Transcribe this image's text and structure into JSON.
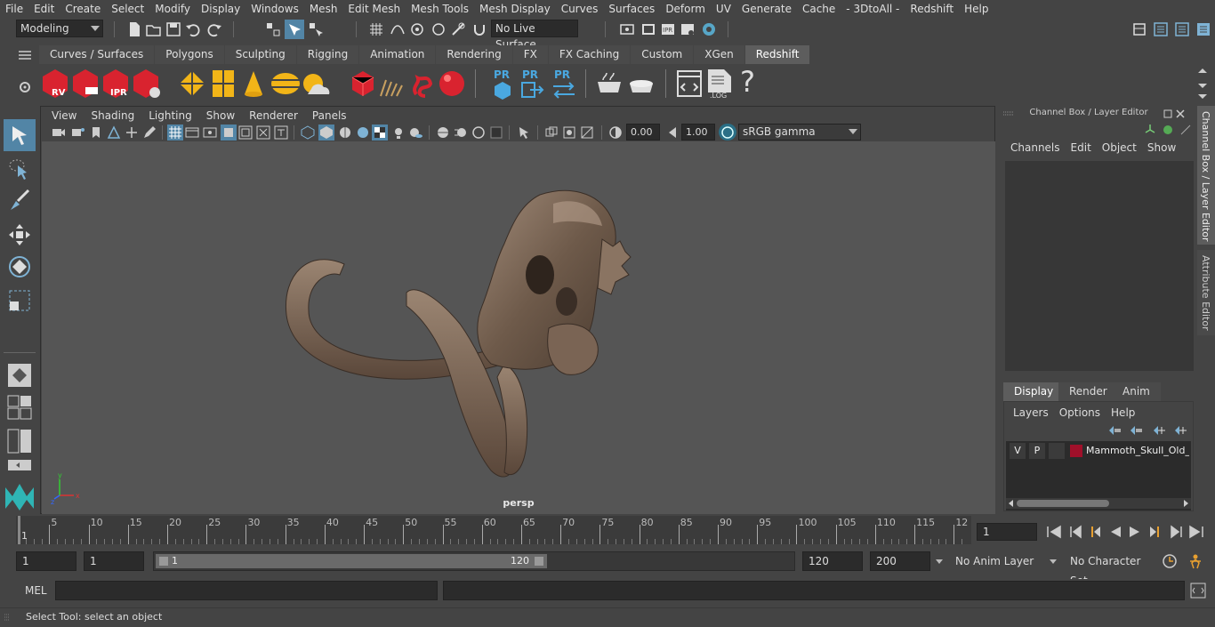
{
  "menubar": {
    "items": [
      "File",
      "Edit",
      "Create",
      "Select",
      "Modify",
      "Display",
      "Windows",
      "Mesh",
      "Edit Mesh",
      "Mesh Tools",
      "Mesh Display",
      "Curves",
      "Surfaces",
      "Deform",
      "UV",
      "Generate",
      "Cache",
      "- 3DtoAll -",
      "Redshift",
      "Help"
    ]
  },
  "statusline": {
    "mode": "Modeling",
    "live_surface": "No Live Surface"
  },
  "shelf": {
    "tabs": [
      "Curves / Surfaces",
      "Polygons",
      "Sculpting",
      "Rigging",
      "Animation",
      "Rendering",
      "FX",
      "FX Caching",
      "Custom",
      "XGen",
      "Redshift"
    ],
    "active_tab": "Redshift",
    "labels": {
      "rv": "RV",
      "ipr": "IPR",
      "pr": "PR",
      "log": ".LOG",
      "help": "?"
    }
  },
  "viewport": {
    "menus": [
      "View",
      "Shading",
      "Lighting",
      "Show",
      "Renderer",
      "Panels"
    ],
    "exposure": "0.00",
    "gamma": "1.00",
    "color_space": "sRGB gamma",
    "camera_label": "persp",
    "axis": {
      "x": "x",
      "y": "y",
      "z": "z"
    }
  },
  "right_panel": {
    "title": "Channel Box / Layer Editor",
    "channel_menus": [
      "Channels",
      "Edit",
      "Object",
      "Show"
    ],
    "layer_tabs": [
      "Display",
      "Render",
      "Anim"
    ],
    "layer_menus": [
      "Layers",
      "Options",
      "Help"
    ],
    "layer": {
      "v": "V",
      "p": "P",
      "name": "Mammoth_Skull_Old_E",
      "color": "#a0102a"
    }
  },
  "side_tabs": [
    "Channel Box / Layer Editor",
    "Attribute Editor"
  ],
  "timeline": {
    "ticks": [
      "5",
      "10",
      "15",
      "20",
      "25",
      "30",
      "35",
      "40",
      "45",
      "50",
      "55",
      "60",
      "65",
      "70",
      "75",
      "80",
      "85",
      "90",
      "95",
      "100",
      "105",
      "110",
      "115",
      "12"
    ],
    "current_frame_marker": "1",
    "current_frame": "1"
  },
  "range": {
    "start": "1",
    "playback_start": "1",
    "slider_start": "1",
    "slider_end": "120",
    "playback_end": "120",
    "end": "200",
    "anim_layer": "No Anim Layer",
    "character_set": "No Character Set"
  },
  "cmdline": {
    "lang": "MEL"
  },
  "helpline": {
    "text": "Select Tool: select an object"
  },
  "colors": {
    "accent": "#5285a6",
    "bg": "#444444",
    "viewport": "#555555"
  }
}
